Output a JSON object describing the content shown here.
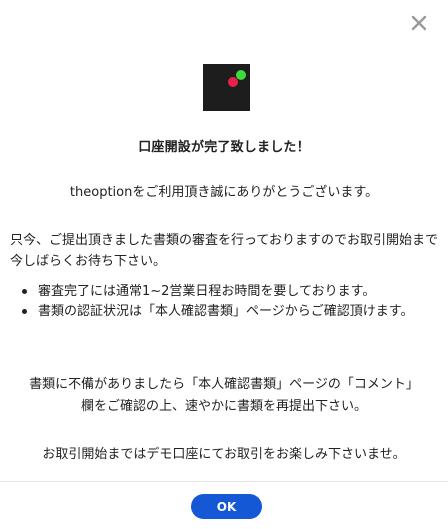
{
  "dialog": {
    "title": "口座開設が完了致しました！",
    "greeting": "theoptionをご利用頂き誠にありがとうございます。",
    "notice": "只今、ご提出頂きました書類の審査を行っておりますのでお取引開始まで今しばらくお待ち下さい。",
    "bullets": [
      "審査完了には通常1~2営業日程お時間を要しております。",
      "書類の認証状況は「本人確認書類」ページからご確認頂けます。"
    ],
    "correction_line1": "書類に不備がありましたら「本人確認書類」ページの「コメント」",
    "correction_line2": "欄をご確認の上、速やかに書類を再提出下さい。",
    "closing": "お取引開始まではデモ口座にてお取引をお楽しみ下さいませ。",
    "ok_label": "OK"
  },
  "icons": {
    "close": "close-icon",
    "logo": "theoption-logo"
  },
  "colors": {
    "logo_bg": "#1d1d1d",
    "logo_dot_green": "#3ddc3d",
    "logo_dot_red": "#e8204a",
    "ok_button": "#1558d6",
    "close_icon": "#9a9a9a"
  }
}
